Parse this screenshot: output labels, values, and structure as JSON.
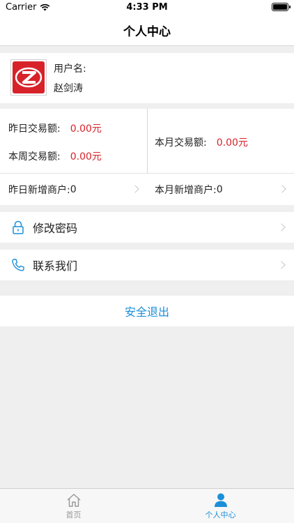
{
  "status": {
    "carrier": "Carrier",
    "time": "4:33 PM"
  },
  "nav": {
    "title": "个人中心"
  },
  "profile": {
    "username_label": "用户名:",
    "username": "赵剑涛",
    "avatar_icon": "brand-logo-icon"
  },
  "stats": {
    "yesterday_label": "昨日交易额:",
    "yesterday_value": "0.00元",
    "week_label": "本周交易额:",
    "week_value": "0.00元",
    "month_label": "本月交易额:",
    "month_value": "0.00元",
    "yesterday_new_label": "昨日新增商户:",
    "yesterday_new_value": "0",
    "month_new_label": "本月新增商户:",
    "month_new_value": "0"
  },
  "menu": {
    "change_password": "修改密码",
    "contact_us": "联系我们"
  },
  "logout": {
    "label": "安全退出"
  },
  "tabbar": {
    "home": "首页",
    "profile": "个人中心"
  },
  "colors": {
    "accent": "#1a8fd8",
    "value_red": "#d8222a"
  }
}
